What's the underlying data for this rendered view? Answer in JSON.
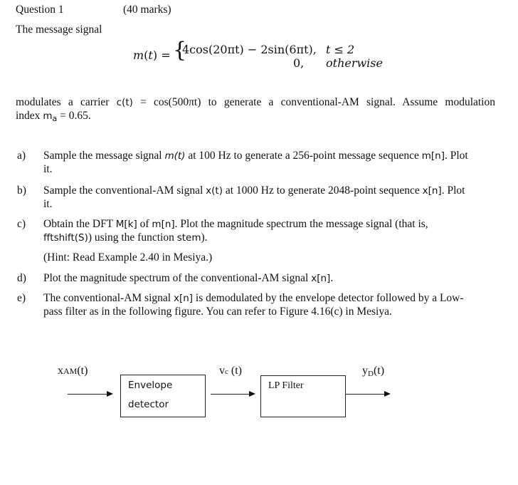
{
  "header": {
    "question_label": "Question 1",
    "marks": "(40 marks)"
  },
  "intro": "The message signal",
  "equation": {
    "lhs": "m(t) =",
    "case1_expr": "4cos(20πt) − 2sin(6πt),",
    "case1_cond": "t ≤ 2",
    "case2_expr": "0,",
    "case2_cond": "otherwise"
  },
  "carrier_text": {
    "line1_a": "modulates a carrier",
    "line1_c": "c(t)",
    "line1_b": "= cos(500πt) to generate a conventional-AM signal. Assume modulation",
    "line2_a": "index",
    "line2_m": "m",
    "line2_sub": "a",
    "line2_b": "= 0.65."
  },
  "parts": [
    {
      "label": "a)",
      "line1_pre": "Sample the message signal",
      "line1_var": "m(t)",
      "line1_post": "at 100 Hz to generate a 256-point message sequence",
      "line1_code": "m[n]",
      "line1_end": ". Plot",
      "line2": "it."
    },
    {
      "label": "b)",
      "line1_pre": "Sample the conventional-AM signal",
      "line1_code": "x(t)",
      "line1_post": "at 1000 Hz to generate 2048-point sequence",
      "line1_code2": "x[n]",
      "line1_end": ". Plot",
      "line2": "it."
    },
    {
      "label": "c)",
      "line1_pre": "Obtain the DFT",
      "line1_code": "M[k]",
      "line1_mid": "of",
      "line1_code2": "m[n]",
      "line1_post": ". Plot the magnitude spectrum the message signal (that is,",
      "line2_code": "fftshift(S)",
      "line2_mid": ") using the function",
      "line2_code2": "stem",
      "line2_end": ").",
      "hint": "(Hint: Read Example 2.40 in Mesiya.)"
    },
    {
      "label": "d)",
      "line1_pre": "Plot the magnitude spectrum of the conventional-AM signal",
      "line1_code": "x[n]",
      "line1_end": "."
    },
    {
      "label": "e)",
      "line1_pre": "The conventional-AM signal",
      "line1_code": "x[n]",
      "line1_post": "is demodulated by the envelope detector followed by a Low-",
      "line2": "pass filter as in the following figure. You can refer to Figure 4.16(c) in Mesiya."
    }
  ],
  "diagram": {
    "input_label": "x",
    "input_sub": "AM",
    "input_arg": "(t)",
    "block1_line1": "Envelope",
    "block1_line2": "detector",
    "mid_label": "v",
    "mid_sub": "c",
    "mid_arg": " (t)",
    "block2_label": "LP Filter",
    "output_label": "y",
    "output_sub": "D",
    "output_arg": "(t)"
  }
}
